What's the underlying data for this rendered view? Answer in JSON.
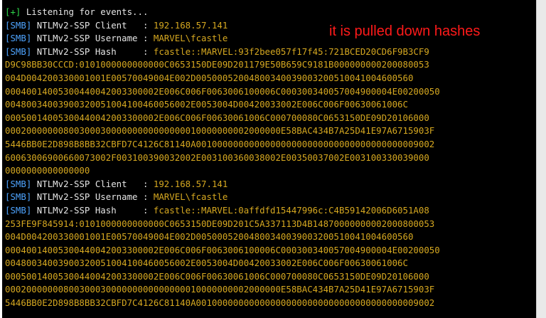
{
  "terminal": {
    "listening": {
      "tag": "[+]",
      "text": " Listening for events..."
    },
    "capture1": {
      "client": {
        "tag": "[SMB]",
        "label": " NTLMv2-SSP Client   : ",
        "value": "192.168.57.141"
      },
      "username": {
        "tag": "[SMB]",
        "label": " NTLMv2-SSP Username : ",
        "value": "MARVEL\\fcastle"
      },
      "hash": {
        "tag": "[SMB]",
        "label": " NTLMv2-SSP Hash     : ",
        "value": "fcastle::MARVEL:93f2bee057f17f45:721BCED20CD6F9B3CF9"
      },
      "continuation": [
        "D9C98BB30CCCD:0101000000000000C0653150DE09D201179E50B659C9181B000000000200080053",
        "004D004200330001001E00570049004E002D00500052004800340039003200510041004600560",
        "00040014005300440042003300002E006C006F0063006100006C000300340057004900004E00200050",
        "00480034003900320051004100460056002E0053004D00420033002E006C006F00630061006C",
        "00050014005300440042003300002E006C006F00630061006C000700080C0653150DE09D20106000",
        "0002000000080030003000000000000000010000000002000000E58BAC434B7A25D41E97A6715903F",
        "5446BB0E2D898B8BB32CBFD7C4126C81140A001000000000000000000000000000000000000009002",
        "60063006900660073002F003100390032002E003100360038002E00350037002E003100330039000",
        "0000000000000000"
      ]
    },
    "capture2": {
      "client": {
        "tag": "[SMB]",
        "label": " NTLMv2-SSP Client   : ",
        "value": "192.168.57.141"
      },
      "username": {
        "tag": "[SMB]",
        "label": " NTLMv2-SSP Username : ",
        "value": "MARVEL\\fcastle"
      },
      "hash": {
        "tag": "[SMB]",
        "label": " NTLMv2-SSP Hash     : ",
        "value": "fcastle::MARVEL:0affdfd15447996c:C4B59142006D6051A08"
      },
      "continuation": [
        "253FE9F845914:0101000000000000C0653150DE09D201C5A337113D4B14870000000002000800053",
        "004D004200330001001E00570049004E002D00500052004800340039003200510041004600560",
        "00040014005300440042003300002E006C006F0063006100006C000300340057004900004E00200050",
        "00480034003900320051004100460056002E0053004D00420033002E006C006F00630061006C",
        "00050014005300440042003300002E006C006F00630061006C000700080C0653150DE09D20106000",
        "0002000000080030003000000000000000010000000002000000E58BAC434B7A25D41E97A6715903F",
        "5446BB0E2D898B8BB32CBFD7C4126C81140A001000000000000000000000000000000000000009002"
      ]
    }
  },
  "annotation": {
    "text": "it is pulled down hashes",
    "color": "#ff1a1a"
  },
  "colors": {
    "background": "#000000",
    "tag_green": "#2ed64a",
    "tag_blue": "#4ea4ff",
    "value_yellow": "#d6a820",
    "label_white": "#e6e6e6"
  }
}
